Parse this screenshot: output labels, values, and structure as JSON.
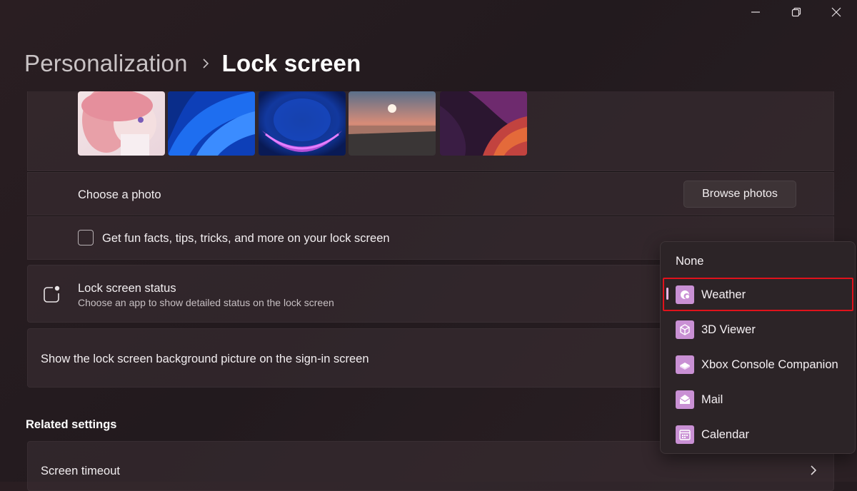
{
  "breadcrumb": {
    "parent": "Personalization",
    "current": "Lock screen"
  },
  "window_controls": {
    "minimize_icon": "minimize-icon",
    "restore_icon": "restore-icon",
    "close_icon": "close-icon"
  },
  "lock_screen": {
    "recent_images_count_shown": 5,
    "choose_photo_label": "Choose a photo",
    "browse_button": "Browse photos",
    "fun_facts_label": "Get fun facts, tips, tricks, and more on your lock screen",
    "fun_facts_checked": false,
    "status_title": "Lock screen status",
    "status_subtitle": "Choose an app to show detailed status on the lock screen",
    "signin_background_label": "Show the lock screen background picture on the sign-in screen"
  },
  "related": {
    "title": "Related settings",
    "screen_timeout": "Screen timeout"
  },
  "dropdown": {
    "selected": "Weather",
    "options": [
      {
        "label": "None",
        "icon": ""
      },
      {
        "label": "Weather",
        "icon": "weather-icon"
      },
      {
        "label": "3D Viewer",
        "icon": "cube-icon"
      },
      {
        "label": "Xbox Console Companion",
        "icon": "xbox-icon"
      },
      {
        "label": "Mail",
        "icon": "mail-icon"
      },
      {
        "label": "Calendar",
        "icon": "calendar-icon"
      }
    ]
  },
  "colors": {
    "background": "#241b1f",
    "card": "#3c3034",
    "accent": "#e7b6e6",
    "app_icon": "#c990d4",
    "highlight_outline": "#e0121b"
  }
}
